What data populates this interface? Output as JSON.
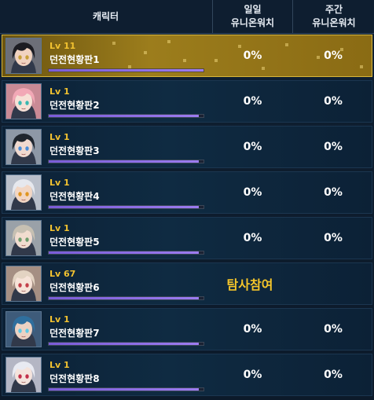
{
  "header": {
    "character": "캐릭터",
    "daily": [
      "일일",
      "유니온워치"
    ],
    "weekly": [
      "주간",
      "유니온워치"
    ]
  },
  "rows": [
    {
      "level": "Lv 11",
      "name": "던전현황판1",
      "daily": "0%",
      "weekly": "0%",
      "progress": 1.0,
      "selected": true,
      "avatar_hair": "#1c1c22",
      "avatar_skin": "#f1d3c0",
      "avatar_eye": "#c8a03a",
      "avatar_bg": "#6d6f78"
    },
    {
      "level": "Lv 1",
      "name": "던전현황판2",
      "daily": "0%",
      "weekly": "0%",
      "progress": 0.97,
      "selected": false,
      "avatar_hair": "#f2a8b6",
      "avatar_skin": "#f6e0d6",
      "avatar_eye": "#3ab7b0",
      "avatar_bg": "#c98a95"
    },
    {
      "level": "Lv 1",
      "name": "던전현황판3",
      "daily": "0%",
      "weekly": "0%",
      "progress": 0.97,
      "selected": false,
      "avatar_hair": "#20262e",
      "avatar_skin": "#f0d9cf",
      "avatar_eye": "#4b8ed8",
      "avatar_bg": "#8e98a6"
    },
    {
      "level": "Lv 1",
      "name": "던전현황판4",
      "daily": "0%",
      "weekly": "0%",
      "progress": 0.97,
      "selected": false,
      "avatar_hair": "#e6e8ee",
      "avatar_skin": "#f2d6c4",
      "avatar_eye": "#e09520",
      "avatar_bg": "#b9bfca"
    },
    {
      "level": "Lv 1",
      "name": "던전현황판5",
      "daily": "0%",
      "weekly": "0%",
      "progress": 0.97,
      "selected": false,
      "avatar_hair": "#c7c0b2",
      "avatar_skin": "#f1dccf",
      "avatar_eye": "#6f9d6d",
      "avatar_bg": "#9aa1a8"
    },
    {
      "level": "Lv 67",
      "name": "던전현황판6",
      "expedition": "탐사참여",
      "progress": 0.97,
      "selected": false,
      "avatar_hair": "#e3d3c2",
      "avatar_skin": "#f6e3d8",
      "avatar_eye": "#c4404a",
      "avatar_bg": "#a58f83"
    },
    {
      "level": "Lv 1",
      "name": "던전현황판7",
      "daily": "0%",
      "weekly": "0%",
      "progress": 0.97,
      "selected": false,
      "avatar_hair": "#2f6f9e",
      "avatar_skin": "#ecd2c3",
      "avatar_eye": "#5ec9e6",
      "avatar_bg": "#3e5b7a"
    },
    {
      "level": "Lv 1",
      "name": "던전현황판8",
      "daily": "0%",
      "weekly": "0%",
      "progress": 0.97,
      "selected": false,
      "avatar_hair": "#e8eaf2",
      "avatar_skin": "#f4e3dc",
      "avatar_eye": "#c2304a",
      "avatar_bg": "#b4b6c4"
    }
  ]
}
